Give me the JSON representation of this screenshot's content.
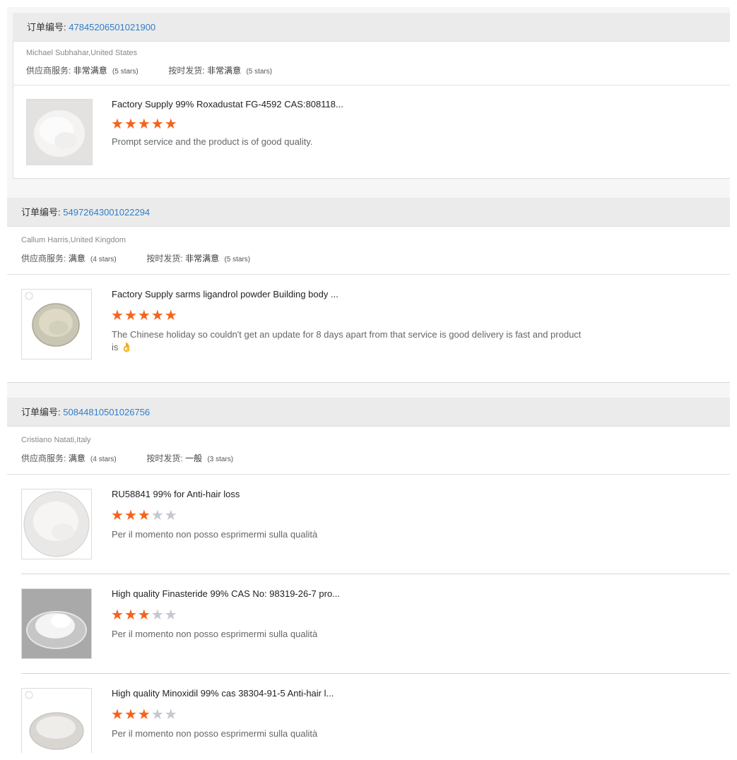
{
  "order_label": "订单编号:",
  "supplier_label": "供应商服务:",
  "delivery_label": "按时发货:",
  "orders": [
    {
      "order_no": "47845206501021900",
      "customer": "Michael Subhahar,United States",
      "supplier_value": "非常满意",
      "supplier_stars": "(5 stars)",
      "delivery_value": "非常满意",
      "delivery_stars": "(5 stars)",
      "items": [
        {
          "title": "Factory Supply 99% Roxadustat FG-4592 CAS:808118...",
          "rating": 5,
          "comment": "Prompt service and the product is of good quality."
        }
      ]
    },
    {
      "order_no": "54972643001022294",
      "customer": "Callum Harris,United Kingdom",
      "supplier_value": "满意",
      "supplier_stars": "(4 stars)",
      "delivery_value": "非常满意",
      "delivery_stars": "(5 stars)",
      "items": [
        {
          "title": "Factory Supply sarms ligandrol powder Building body ...",
          "rating": 5,
          "comment": "The Chinese holiday so couldn't get an update for 8 days apart from that service is good delivery is fast and product is 👌"
        }
      ]
    },
    {
      "order_no": "50844810501026756",
      "customer": "Cristiano Natati,Italy",
      "supplier_value": "满意",
      "supplier_stars": "(4 stars)",
      "delivery_value": "一般",
      "delivery_stars": "(3 stars)",
      "items": [
        {
          "title": "RU58841 99% for Anti-hair loss",
          "rating": 3,
          "comment": "Per il momento non posso esprimermi sulla qualità"
        },
        {
          "title": "High quality Finasteride 99% CAS No: 98319-26-7 pro...",
          "rating": 3,
          "comment": "Per il momento non posso esprimermi sulla qualità"
        },
        {
          "title": "High quality Minoxidil 99% cas 38304-91-5 Anti-hair l...",
          "rating": 3,
          "comment": "Per il momento non posso esprimermi sulla qualità"
        }
      ]
    }
  ]
}
